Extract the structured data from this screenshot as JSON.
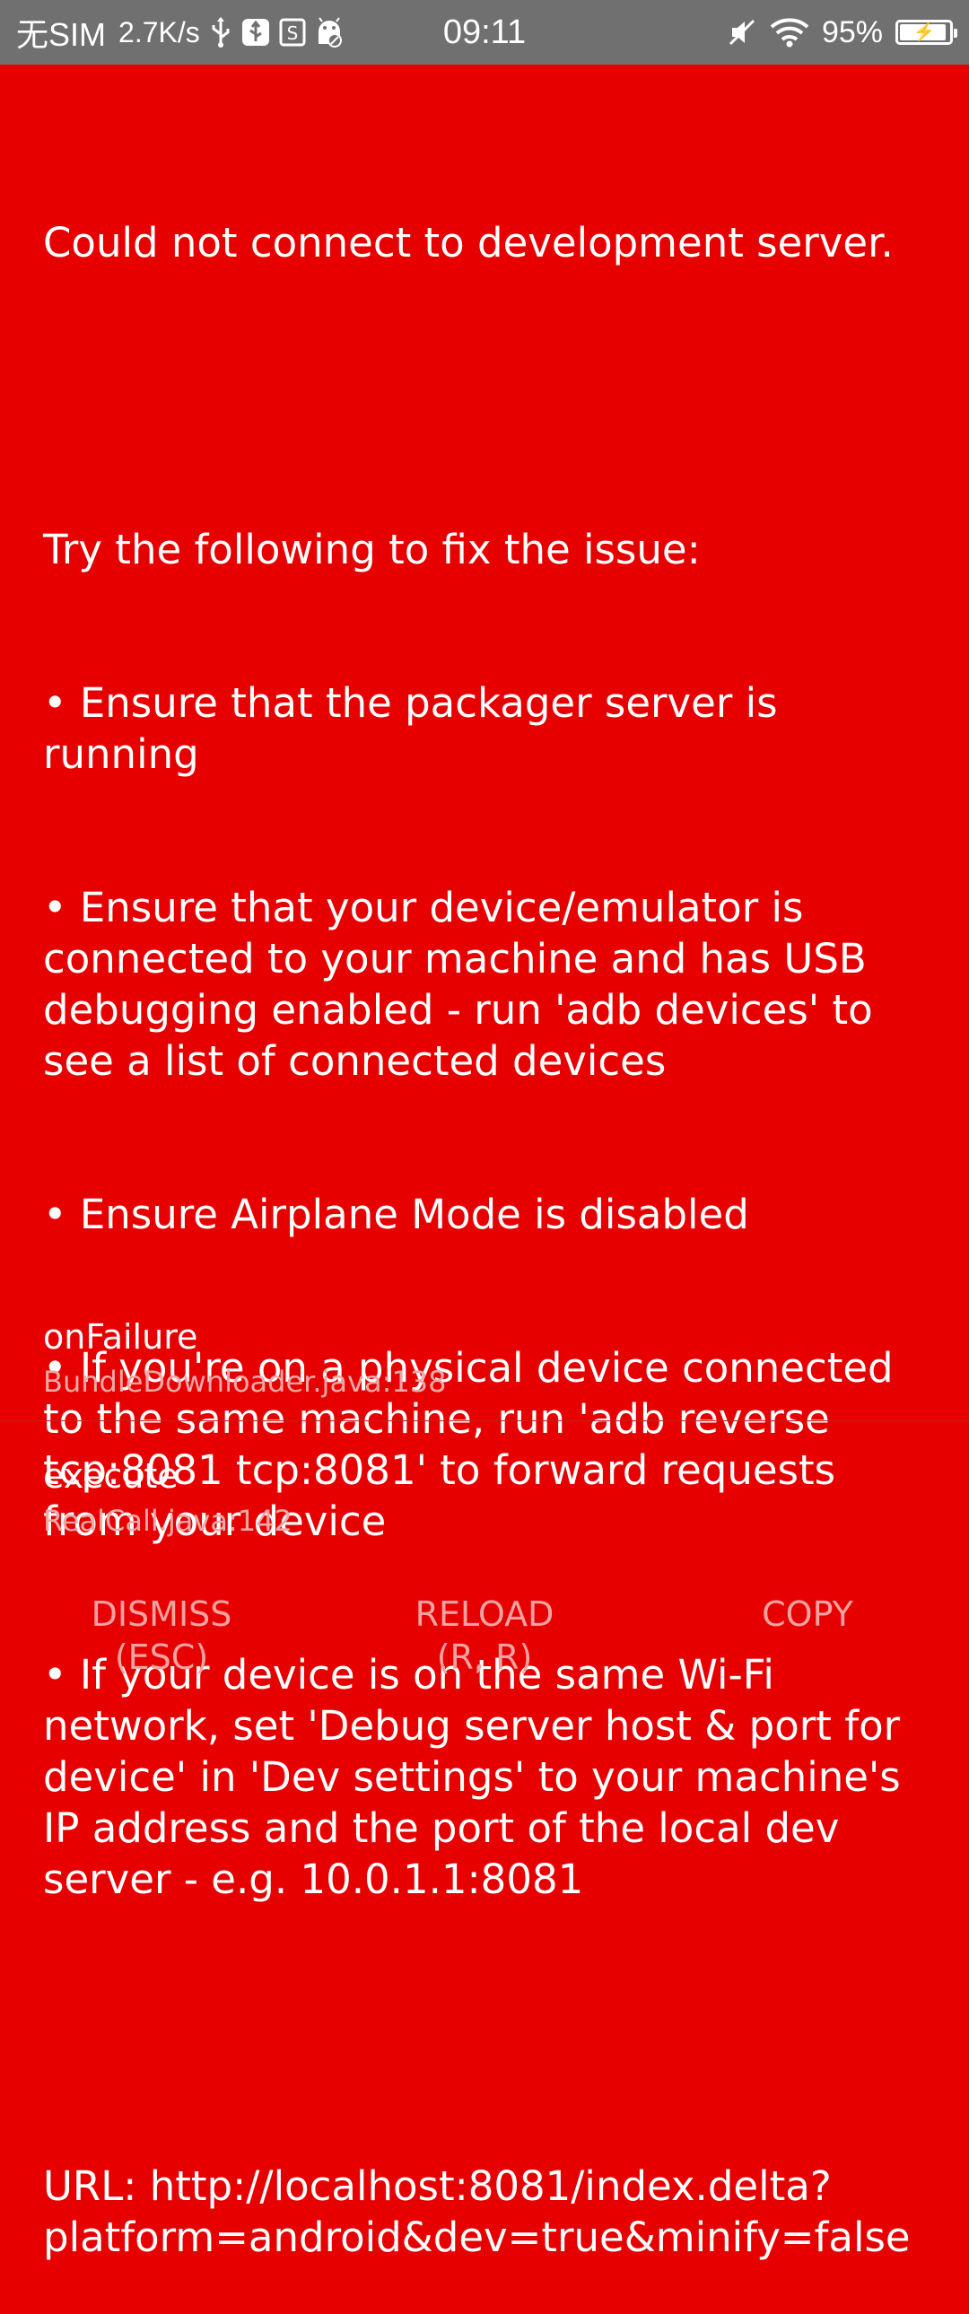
{
  "status_bar": {
    "carrier": "无SIM",
    "speed": "2.7K/s",
    "time": "09:11",
    "battery_percent": "95%",
    "battery_level": 0.95,
    "icons_left": [
      "usb-icon",
      "usb-debug-icon",
      "sim-storage-icon",
      "android-debug-icon"
    ],
    "icons_right": [
      "mute-icon",
      "wifi-icon",
      "battery-charging-icon"
    ]
  },
  "error": {
    "title": "Could not connect to development server.",
    "intro": "Try the following to fix the issue:",
    "bullets": [
      "• Ensure that the packager server is running",
      "• Ensure that your device/emulator is connected to your machine and has USB debugging enabled - run 'adb devices' to see a list of connected devices",
      "• Ensure Airplane Mode is disabled",
      "• If you're on a physical device connected to the same machine, run 'adb reverse tcp:8081 tcp:8081' to forward requests from your device",
      "• If your device is on the same Wi-Fi network, set 'Debug server host & port for device' in 'Dev settings' to your machine's IP address and the port of the local dev server - e.g. 10.0.1.1:8081"
    ],
    "url": "URL: http://localhost:8081/index.delta?platform=android&dev=true&minify=false"
  },
  "stack": [
    {
      "method": "onFailure",
      "file": "BundleDownloader.java:138"
    },
    {
      "method": "execute",
      "file": "RealCall.java:142"
    }
  ],
  "buttons": {
    "dismiss": {
      "line1": "DISMISS",
      "line2": "(ESC)"
    },
    "reload": {
      "line1": "RELOAD",
      "line2": "(R, R)"
    },
    "copy": {
      "line1": "COPY",
      "line2": ""
    }
  },
  "colors": {
    "background": "#e60000",
    "status_bar": "#707070",
    "text": "#ffffff",
    "muted_text": "#f3a2a2"
  }
}
